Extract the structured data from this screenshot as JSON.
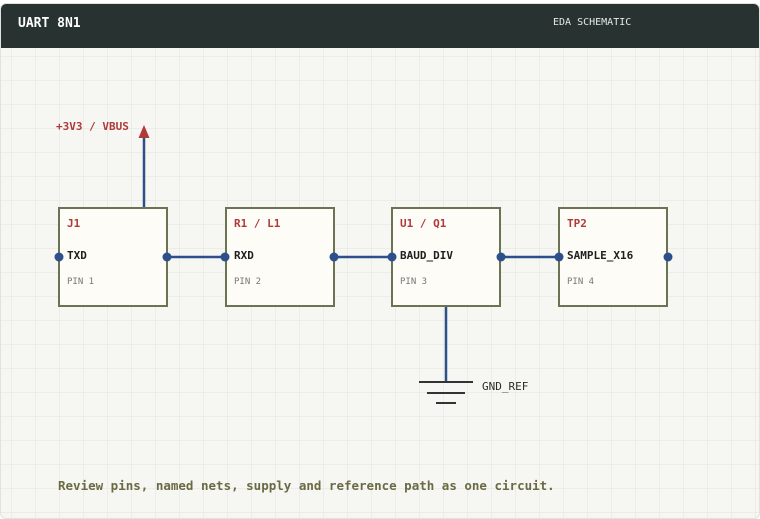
{
  "header": {
    "title": "UART 8N1",
    "subtitle": "EDA SCHEMATIC"
  },
  "supply": {
    "label": "+3V3 / VBUS"
  },
  "ground": {
    "label": "GND_REF"
  },
  "components": [
    {
      "ref": "J1",
      "signal": "TXD",
      "pin": "PIN 1"
    },
    {
      "ref": "R1 / L1",
      "signal": "RXD",
      "pin": "PIN 2"
    },
    {
      "ref": "U1 / Q1",
      "signal": "BAUD_DIV",
      "pin": "PIN 3"
    },
    {
      "ref": "TP2",
      "signal": "SAMPLE_X16",
      "pin": "PIN 4"
    }
  ],
  "footer": {
    "note": "Review pins, named nets, supply and reference path as one circuit."
  },
  "colors": {
    "wire": "#2d4f8c",
    "ref_text": "#b03a3a",
    "supply": "#b03a3a",
    "box_border": "#6b7353",
    "box_fill": "#fdfcf7",
    "note_text": "#6b6a45",
    "grid": "#e3e4dc"
  }
}
